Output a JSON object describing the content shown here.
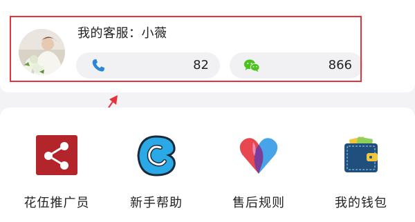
{
  "contact": {
    "title": "我的客服：小薇",
    "phone_value": "82",
    "wechat_value": "866"
  },
  "menu": {
    "items": [
      {
        "label": "花伍推广员",
        "icon": "share-icon"
      },
      {
        "label": "新手帮助",
        "icon": "help-c-icon"
      },
      {
        "label": "售后规则",
        "icon": "heart-icon"
      },
      {
        "label": "我的钱包",
        "icon": "wallet-icon"
      }
    ]
  },
  "colors": {
    "highlight": "#e8313c",
    "phone_icon": "#2a86d6",
    "wechat_icon": "#4cc21f",
    "share_bg": "#b4242b",
    "help_blue": "#2ba8e6",
    "wallet": "#1f4f7d"
  }
}
